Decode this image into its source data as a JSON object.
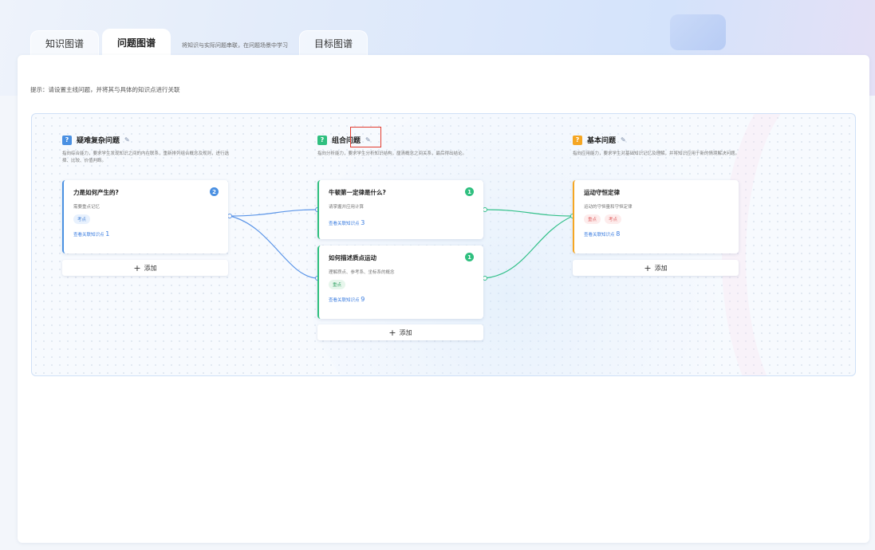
{
  "tabs": [
    {
      "label": "知识图谱"
    },
    {
      "label": "问题图谱"
    },
    {
      "label": "目标图谱"
    }
  ],
  "tab_hint": "将知识与实际问题串联，在问题场景中学习",
  "hint": "提示：请设置主线问题，并将其与具体的知识点进行关联",
  "colors": {
    "blue": "#4a90e2",
    "green": "#2fbf7f",
    "orange": "#f5a623",
    "highlight": "#e23b2e"
  },
  "columns": [
    {
      "badge": "?",
      "title": "疑难复杂问题",
      "desc": "指向综合能力，要求学生发现知识之间的内在联系，重新排列组合概念及规则，进行选择、比较、价值判断。",
      "cards": [
        {
          "title": "力是如何产生的?",
          "sub": "需要重点记忆",
          "tags": [
            "考点"
          ],
          "link": "查看关联知识点",
          "link_count": "1",
          "count": "2"
        }
      ],
      "add": "添加"
    },
    {
      "badge": "?",
      "title": "组合问题",
      "desc": "指向分析能力，要求学生分析知识结构，厘清概念之间关系，最后得出结论。",
      "cards": [
        {
          "title": "牛顿第一定律是什么?",
          "sub": "请掌握并应用计算",
          "tags": [],
          "link": "查看关联知识点",
          "link_count": "3",
          "count": "1"
        },
        {
          "title": "如何描述质点运动",
          "sub": "理解质点、参考系、坐标系的概念",
          "tags": [
            "重点"
          ],
          "link": "查看关联知识点",
          "link_count": "9",
          "count": "1"
        }
      ],
      "add": "添加"
    },
    {
      "badge": "?",
      "title": "基本问题",
      "desc": "指向应用能力，要求学生对基础知识记忆及理解，并将知识应用于新的情境解决问题。",
      "cards": [
        {
          "title": "运动守恒定律",
          "sub": "运动的守恒量和守恒定律",
          "tags": [
            "重点",
            "考点"
          ],
          "link": "查看关联知识点",
          "link_count": "8",
          "count": ""
        }
      ],
      "add": "添加"
    }
  ],
  "icons": {
    "edit": "pencil-icon",
    "add": "plus-icon",
    "question": "question-badge-icon"
  }
}
